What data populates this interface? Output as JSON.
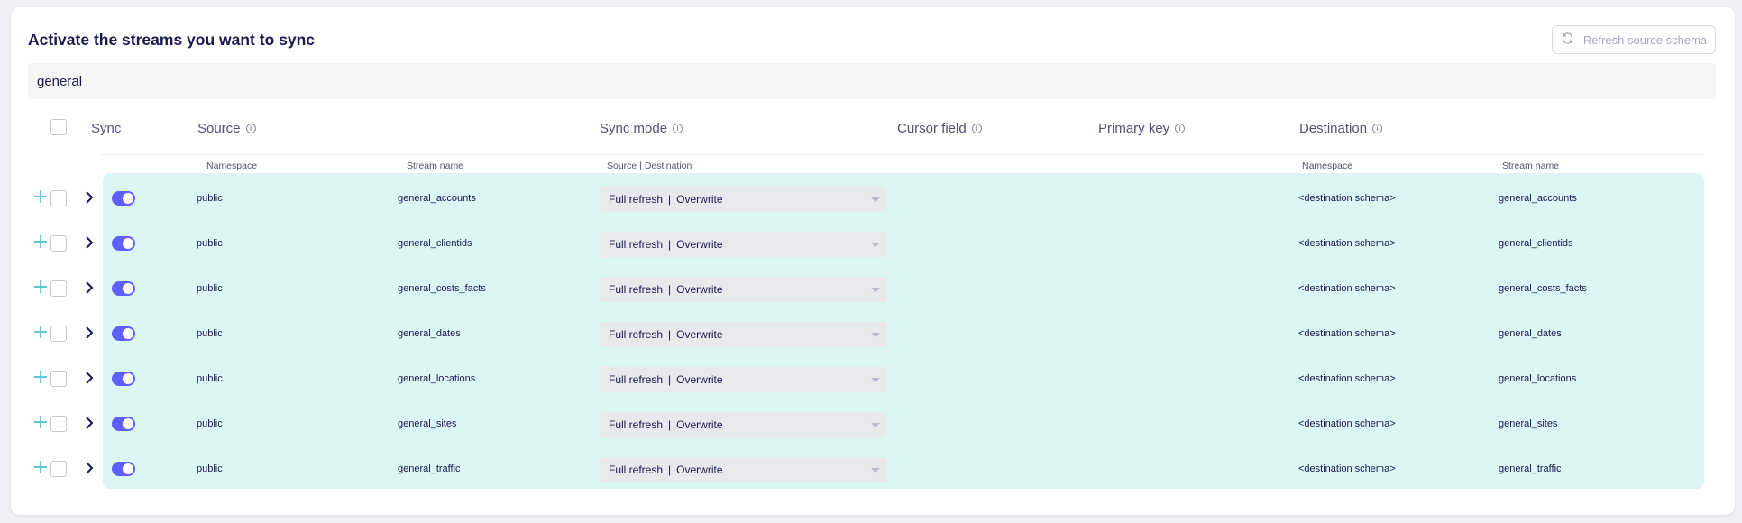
{
  "title": "Activate the streams you want to sync",
  "refresh_button": "Refresh source schema",
  "search_value": "general",
  "headers": {
    "sync": "Sync",
    "source": "Source",
    "sync_mode": "Sync mode",
    "cursor_field": "Cursor field",
    "primary_key": "Primary key",
    "destination": "Destination"
  },
  "subheaders": {
    "source_namespace": "Namespace",
    "source_stream_name": "Stream name",
    "sync_mode": "Source | Destination",
    "dest_namespace": "Namespace",
    "dest_stream_name": "Stream name"
  },
  "info_glyph": "i",
  "rows": [
    {
      "namespace": "public",
      "stream": "general_accounts",
      "mode_source": "Full refresh",
      "mode_sep": "|",
      "mode_dest": "Overwrite",
      "dest_namespace": "<destination schema>",
      "dest_stream": "general_accounts"
    },
    {
      "namespace": "public",
      "stream": "general_clientids",
      "mode_source": "Full refresh",
      "mode_sep": "|",
      "mode_dest": "Overwrite",
      "dest_namespace": "<destination schema>",
      "dest_stream": "general_clientids"
    },
    {
      "namespace": "public",
      "stream": "general_costs_facts",
      "mode_source": "Full refresh",
      "mode_sep": "|",
      "mode_dest": "Overwrite",
      "dest_namespace": "<destination schema>",
      "dest_stream": "general_costs_facts"
    },
    {
      "namespace": "public",
      "stream": "general_dates",
      "mode_source": "Full refresh",
      "mode_sep": "|",
      "mode_dest": "Overwrite",
      "dest_namespace": "<destination schema>",
      "dest_stream": "general_dates"
    },
    {
      "namespace": "public",
      "stream": "general_locations",
      "mode_source": "Full refresh",
      "mode_sep": "|",
      "mode_dest": "Overwrite",
      "dest_namespace": "<destination schema>",
      "dest_stream": "general_locations"
    },
    {
      "namespace": "public",
      "stream": "general_sites",
      "mode_source": "Full refresh",
      "mode_sep": "|",
      "mode_dest": "Overwrite",
      "dest_namespace": "<destination schema>",
      "dest_stream": "general_sites"
    },
    {
      "namespace": "public",
      "stream": "general_traffic",
      "mode_source": "Full refresh",
      "mode_sep": "|",
      "mode_dest": "Overwrite",
      "dest_namespace": "<destination schema>",
      "dest_stream": "general_traffic"
    }
  ],
  "colors": {
    "accent": "#615eff",
    "row_bg": "#dcf5f5",
    "plus": "#5cc8d6"
  }
}
